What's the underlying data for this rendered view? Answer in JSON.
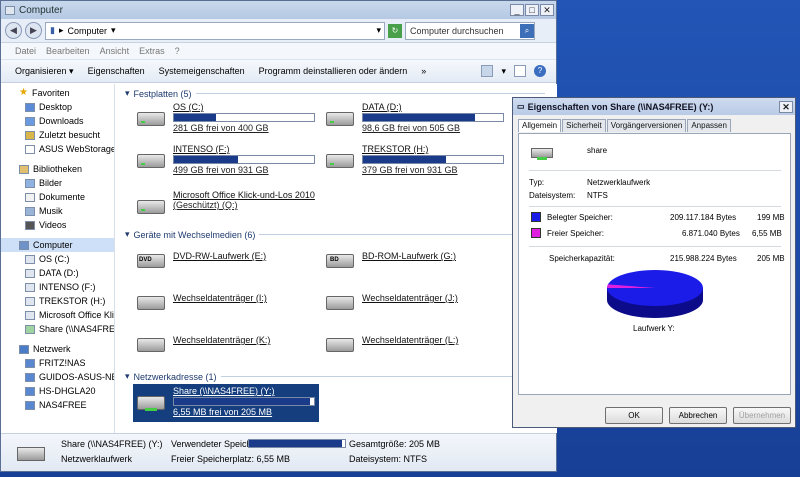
{
  "window": {
    "title": "Computer"
  },
  "address": {
    "path": "Computer",
    "search_placeholder": "Computer durchsuchen"
  },
  "menu": [
    "Datei",
    "Bearbeiten",
    "Ansicht",
    "Extras",
    "?"
  ],
  "toolbar": {
    "organize": "Organisieren",
    "properties": "Eigenschaften",
    "system_properties": "Systemeigenschaften",
    "uninstall": "Programm deinstallieren oder ändern",
    "more": "»"
  },
  "sidebar": {
    "favorites": {
      "label": "Favoriten",
      "items": [
        "Desktop",
        "Downloads",
        "Zuletzt besucht",
        "ASUS WebStorage"
      ]
    },
    "libraries": {
      "label": "Bibliotheken",
      "items": [
        "Bilder",
        "Dokumente",
        "Musik",
        "Videos"
      ]
    },
    "computer": {
      "label": "Computer",
      "items": [
        "OS (C:)",
        "DATA (D:)",
        "INTENSO (F:)",
        "TREKSTOR (H:)",
        "Microsoft Office Klic",
        "Share (\\\\NAS4FREE"
      ]
    },
    "network": {
      "label": "Netzwerk",
      "items": [
        "FRITZ!NAS",
        "GUIDOS-ASUS-NB",
        "HS-DHGLA20",
        "NAS4FREE"
      ]
    }
  },
  "sections": {
    "hdd": "Festplatten (5)",
    "removable": "Geräte mit Wechselmedien (6)",
    "network": "Netzwerkadresse (1)"
  },
  "hdd_drives": [
    {
      "name": "OS (C:)",
      "free": "281 GB frei von 400 GB",
      "used_fraction": 0.3
    },
    {
      "name": "DATA (D:)",
      "free": "98,6 GB frei von 505 GB",
      "used_fraction": 0.8
    },
    {
      "name": "INTENSO (F:)",
      "free": "499 GB frei von 931 GB",
      "used_fraction": 0.46
    },
    {
      "name": "TREKSTOR (H:)",
      "free": "379 GB frei von 931 GB",
      "used_fraction": 0.59
    },
    {
      "name": "Microsoft Office Klick-und-Los 2010",
      "free": "(Geschützt) (Q:)",
      "used_fraction": null
    }
  ],
  "removable_drives": [
    {
      "name": "DVD-RW-Laufwerk (E:)"
    },
    {
      "name": "BD-ROM-Laufwerk (G:)"
    },
    {
      "name": "Wechseldatenträger (I:)"
    },
    {
      "name": "Wechseldatenträger (J:)"
    },
    {
      "name": "Wechseldatenträger (K:)"
    },
    {
      "name": "Wechseldatenträger (L:)"
    }
  ],
  "network_drives": [
    {
      "name": "Share (\\\\NAS4FREE) (Y:)",
      "free": "6,55 MB frei von 205 MB",
      "used_fraction": 0.97
    }
  ],
  "statusbar": {
    "name": "Share (\\\\NAS4FREE) (Y:)",
    "type": "Netzwerklaufwerk",
    "used_label": "Verwendeter Speich...",
    "used_fraction": 0.97,
    "free_label": "Freier Speicherplatz: 6,55 MB",
    "total_label": "Gesamtgröße: 205 MB",
    "fs_label": "Dateisystem: NTFS"
  },
  "props": {
    "title": "Eigenschaften von Share (\\\\NAS4FREE) (Y:)",
    "tabs": [
      "Allgemein",
      "Sicherheit",
      "Vorgängerversionen",
      "Anpassen"
    ],
    "name": "share",
    "type_label": "Typ:",
    "type_value": "Netzwerklaufwerk",
    "fs_label": "Dateisystem:",
    "fs_value": "NTFS",
    "used_label": "Belegter Speicher:",
    "used_bytes": "209.117.184 Bytes",
    "used_size": "199 MB",
    "free_label": "Freier Speicher:",
    "free_bytes": "6.871.040 Bytes",
    "free_size": "6,55 MB",
    "cap_label": "Speicherkapazität:",
    "cap_bytes": "215.988.224 Bytes",
    "cap_size": "205 MB",
    "drive_label": "Laufwerk Y:",
    "used_color": "#1c1ce8",
    "free_color": "#e020e0",
    "used_fraction": 0.968,
    "ok": "OK",
    "cancel": "Abbrechen",
    "apply": "Übernehmen"
  }
}
